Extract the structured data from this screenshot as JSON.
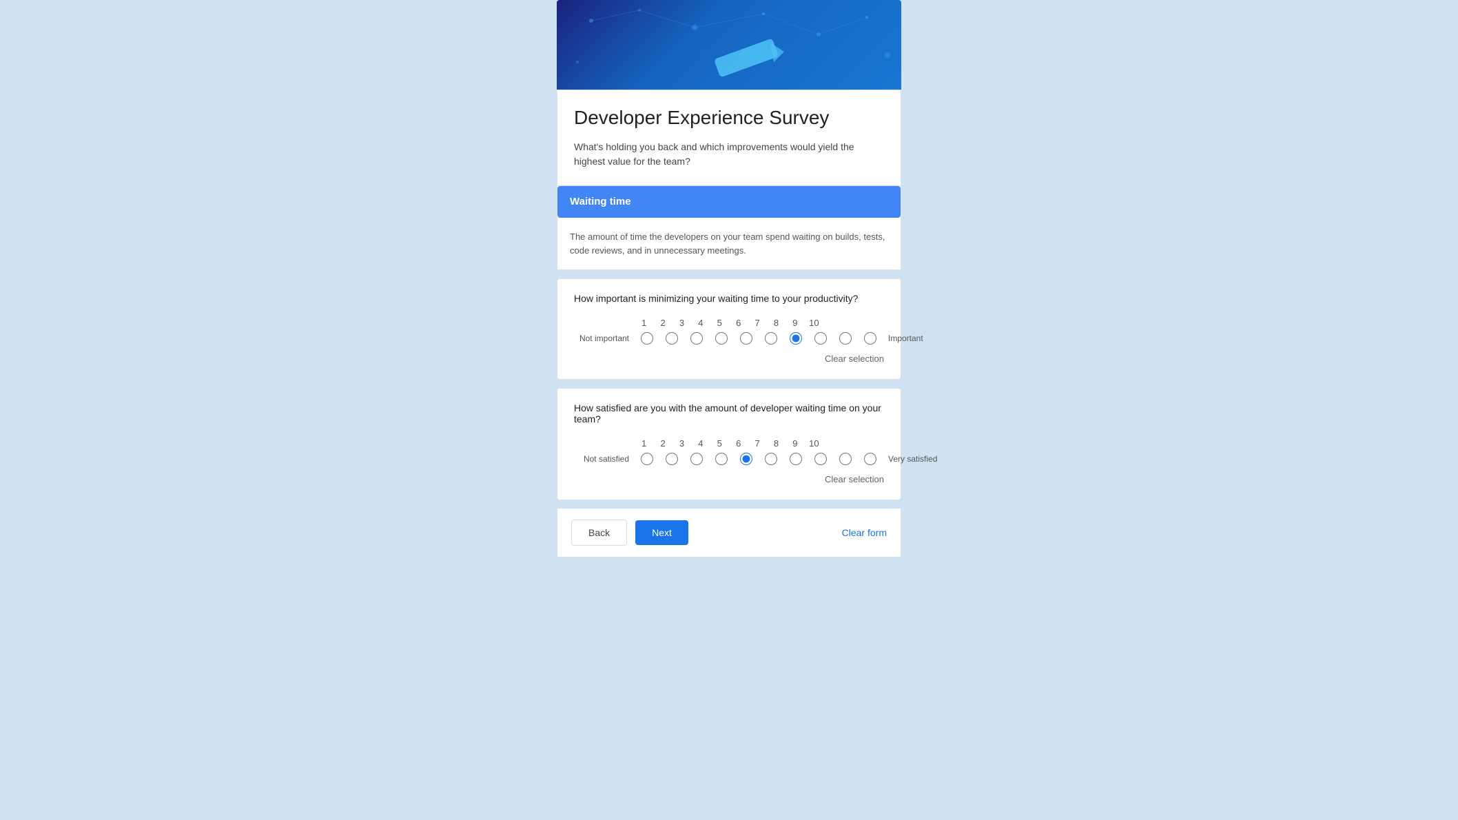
{
  "header": {
    "alt": "Developer Experience Survey banner"
  },
  "survey": {
    "title": "Developer Experience Survey",
    "description": "What's holding you back and which improvements would yield the highest value for the team?"
  },
  "section": {
    "title": "Waiting time",
    "description": "The amount of time the developers on your team spend waiting on builds, tests, code reviews, and in unnecessary meetings."
  },
  "questions": [
    {
      "id": "q1",
      "text": "How important is minimizing your waiting time to your productivity?",
      "label_left": "Not important",
      "label_right": "Important",
      "scale": [
        1,
        2,
        3,
        4,
        5,
        6,
        7,
        8,
        9,
        10
      ],
      "selected": 7
    },
    {
      "id": "q2",
      "text": "How satisfied are you with the amount of developer waiting time on your team?",
      "label_left": "Not satisfied",
      "label_right": "Very satisfied",
      "scale": [
        1,
        2,
        3,
        4,
        5,
        6,
        7,
        8,
        9,
        10
      ],
      "selected": 5
    }
  ],
  "clear_selection_label": "Clear selection",
  "footer": {
    "back_label": "Back",
    "next_label": "Next",
    "clear_form_label": "Clear form"
  }
}
